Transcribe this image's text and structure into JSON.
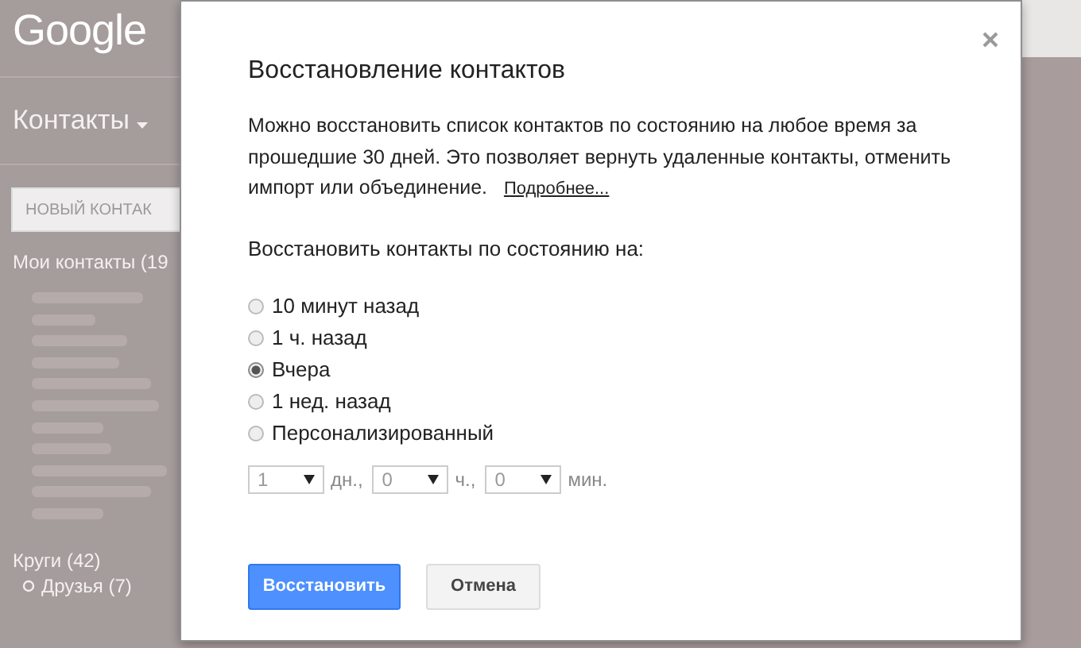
{
  "background": {
    "logo": "Google",
    "app_menu": "Контакты",
    "new_contact_button": "НОВЫЙ КОНТАК",
    "my_contacts": "Мои контакты (19",
    "circles": "Круги (42)",
    "circle_items": [
      "Друзья (7)"
    ]
  },
  "dialog": {
    "title": "Восстановление контактов",
    "description": "Можно восстановить список контактов по состоянию на любое время за прошедшие 30 дней. Это позволяет вернуть удаленные контакты, отменить импорт или объединение.",
    "more_link": "Подробнее...",
    "prompt": "Восстановить контакты по состоянию на:",
    "options": [
      {
        "label": "10 минут назад",
        "selected": false
      },
      {
        "label": "1 ч. назад",
        "selected": false
      },
      {
        "label": "Вчера",
        "selected": true
      },
      {
        "label": "1 нед. назад",
        "selected": false
      },
      {
        "label": "Персонализированный",
        "selected": false
      }
    ],
    "custom": [
      {
        "value": "1",
        "unit": "дн.,"
      },
      {
        "value": "0",
        "unit": "ч.,"
      },
      {
        "value": "0",
        "unit": "мин."
      }
    ],
    "buttons": [
      {
        "label": "Восстановить",
        "kind": "primary"
      },
      {
        "label": "Отмена",
        "kind": "secondary"
      }
    ]
  }
}
